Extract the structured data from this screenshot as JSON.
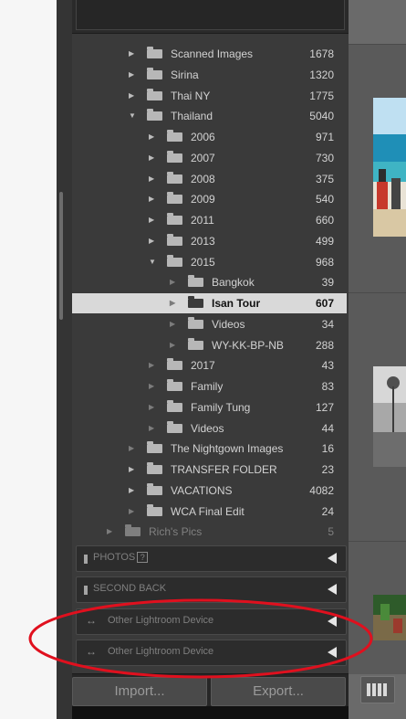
{
  "tree": [
    {
      "label": "Scanned Images",
      "count": "1678",
      "level": 1,
      "expanded": false,
      "ghost": false,
      "selected": false,
      "dim": false
    },
    {
      "label": "Sirina",
      "count": "1320",
      "level": 1,
      "expanded": false,
      "ghost": false,
      "selected": false,
      "dim": false
    },
    {
      "label": "Thai NY",
      "count": "1775",
      "level": 1,
      "expanded": false,
      "ghost": false,
      "selected": false,
      "dim": false
    },
    {
      "label": "Thailand",
      "count": "5040",
      "level": 1,
      "expanded": true,
      "ghost": false,
      "selected": false,
      "dim": false
    },
    {
      "label": "2006",
      "count": "971",
      "level": 2,
      "expanded": false,
      "ghost": false,
      "selected": false,
      "dim": false
    },
    {
      "label": "2007",
      "count": "730",
      "level": 2,
      "expanded": false,
      "ghost": false,
      "selected": false,
      "dim": false
    },
    {
      "label": "2008",
      "count": "375",
      "level": 2,
      "expanded": false,
      "ghost": false,
      "selected": false,
      "dim": false
    },
    {
      "label": "2009",
      "count": "540",
      "level": 2,
      "expanded": false,
      "ghost": false,
      "selected": false,
      "dim": false
    },
    {
      "label": "2011",
      "count": "660",
      "level": 2,
      "expanded": false,
      "ghost": false,
      "selected": false,
      "dim": false
    },
    {
      "label": "2013",
      "count": "499",
      "level": 2,
      "expanded": false,
      "ghost": false,
      "selected": false,
      "dim": false
    },
    {
      "label": "2015",
      "count": "968",
      "level": 2,
      "expanded": true,
      "ghost": false,
      "selected": false,
      "dim": false
    },
    {
      "label": "Bangkok",
      "count": "39",
      "level": 3,
      "expanded": false,
      "ghost": true,
      "selected": false,
      "dim": false
    },
    {
      "label": "Isan Tour",
      "count": "607",
      "level": 3,
      "expanded": false,
      "ghost": true,
      "selected": true,
      "dim": false
    },
    {
      "label": "Videos",
      "count": "34",
      "level": 3,
      "expanded": false,
      "ghost": true,
      "selected": false,
      "dim": false
    },
    {
      "label": "WY-KK-BP-NB",
      "count": "288",
      "level": 3,
      "expanded": false,
      "ghost": true,
      "selected": false,
      "dim": false
    },
    {
      "label": "2017",
      "count": "43",
      "level": 2,
      "expanded": false,
      "ghost": true,
      "selected": false,
      "dim": false
    },
    {
      "label": "Family",
      "count": "83",
      "level": 2,
      "expanded": false,
      "ghost": true,
      "selected": false,
      "dim": false
    },
    {
      "label": "Family Tung",
      "count": "127",
      "level": 2,
      "expanded": false,
      "ghost": true,
      "selected": false,
      "dim": false
    },
    {
      "label": "Videos",
      "count": "44",
      "level": 2,
      "expanded": false,
      "ghost": true,
      "selected": false,
      "dim": false
    },
    {
      "label": "The Nightgown Images",
      "count": "16",
      "level": 1,
      "expanded": false,
      "ghost": true,
      "selected": false,
      "dim": false
    },
    {
      "label": "TRANSFER FOLDER",
      "count": "23",
      "level": 1,
      "expanded": false,
      "ghost": false,
      "selected": false,
      "dim": false
    },
    {
      "label": "VACATIONS",
      "count": "4082",
      "level": 1,
      "expanded": false,
      "ghost": false,
      "selected": false,
      "dim": false
    },
    {
      "label": "WCA Final Edit",
      "count": "24",
      "level": 1,
      "expanded": false,
      "ghost": true,
      "selected": false,
      "dim": false
    },
    {
      "label": "Rich's Pics",
      "count": "5",
      "level": 0,
      "expanded": false,
      "ghost": true,
      "selected": false,
      "dim": true
    }
  ],
  "sections": [
    {
      "title": "PHOTOS",
      "help": true,
      "sync": false
    },
    {
      "title": "SECOND BACK",
      "help": false,
      "sync": false
    },
    {
      "title": "Other Lightroom Device",
      "help": false,
      "sync": true
    },
    {
      "title": "Other Lightroom Device",
      "help": false,
      "sync": true
    }
  ],
  "buttons": {
    "import": "Import...",
    "export": "Export..."
  },
  "colors": {
    "annotation_ring": "#e0101e",
    "selected_row": "#d9d9d9",
    "panel": "#3a3a3a"
  }
}
